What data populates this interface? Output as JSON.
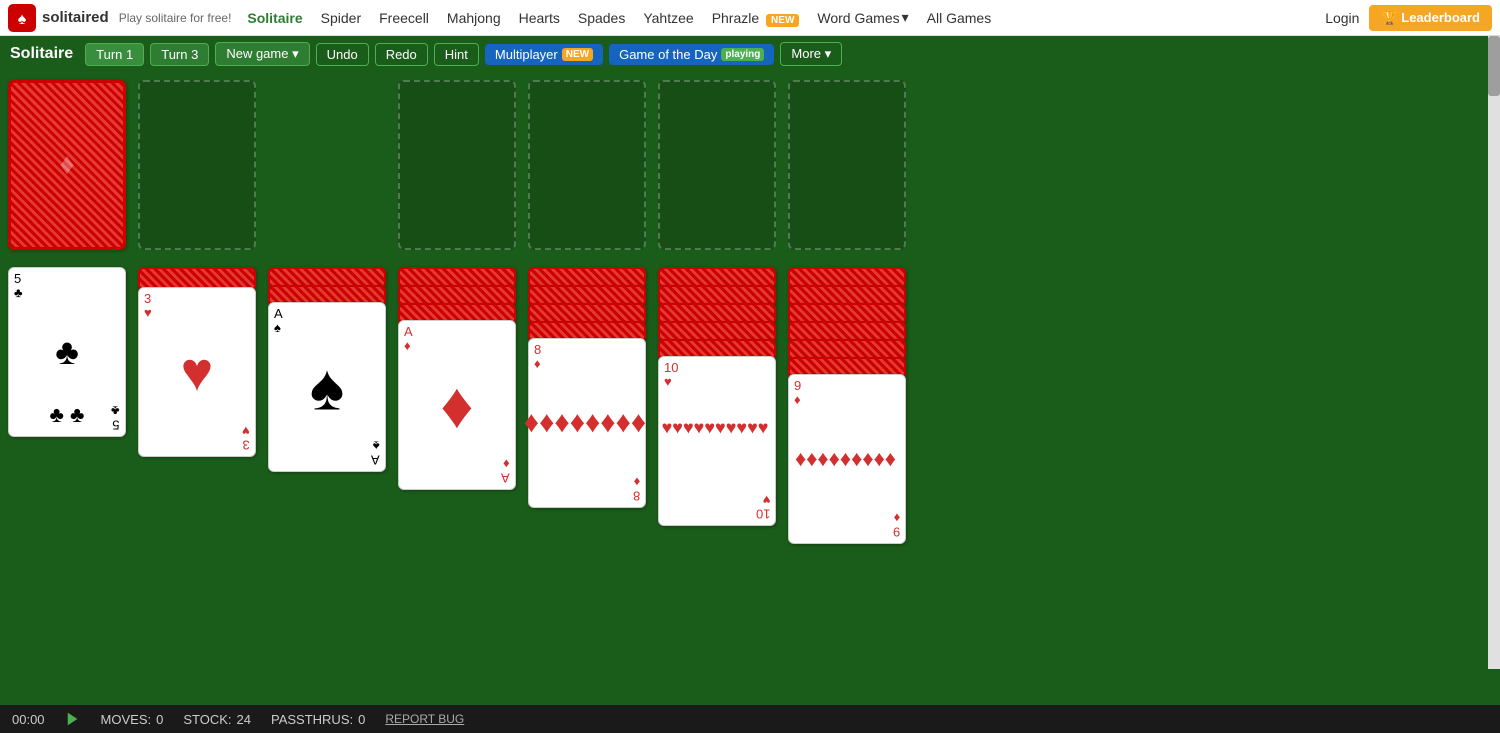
{
  "nav": {
    "logo_text": "solitaired",
    "tagline": "Play solitaire for free!",
    "links": [
      {
        "label": "Solitaire",
        "active": true
      },
      {
        "label": "Spider",
        "active": false
      },
      {
        "label": "Freecell",
        "active": false
      },
      {
        "label": "Mahjong",
        "active": false
      },
      {
        "label": "Hearts",
        "active": false
      },
      {
        "label": "Spades",
        "active": false
      },
      {
        "label": "Yahtzee",
        "active": false
      },
      {
        "label": "Phrazle",
        "active": false,
        "badge": "NEW"
      },
      {
        "label": "Word Games",
        "active": false,
        "dropdown": true
      },
      {
        "label": "All Games",
        "active": false
      }
    ],
    "login_label": "Login",
    "leaderboard_label": "🏆 Leaderboard"
  },
  "toolbar": {
    "game_title": "Solitaire",
    "turn1_label": "Turn 1",
    "turn3_label": "Turn 3",
    "new_game_label": "New game",
    "undo_label": "Undo",
    "redo_label": "Redo",
    "hint_label": "Hint",
    "multiplayer_label": "Multiplayer",
    "multiplayer_badge": "NEW",
    "gotd_label": "Game of the Day",
    "gotd_badge": "playing",
    "more_label": "More ▾"
  },
  "status": {
    "timer": "00:00",
    "moves_label": "MOVES:",
    "moves_value": "0",
    "stock_label": "STOCK:",
    "stock_value": "24",
    "passthrus_label": "PASSTHRUS:",
    "passthrus_value": "0",
    "report_bug": "REPORT BUG"
  }
}
